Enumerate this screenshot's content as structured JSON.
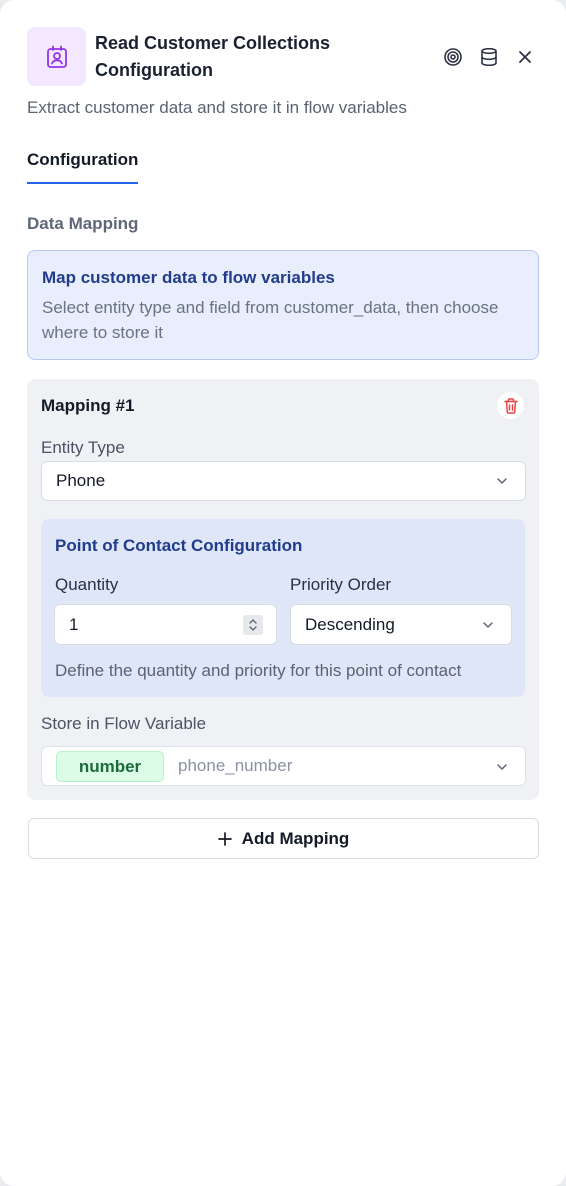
{
  "header": {
    "title": "Read Customer Collections Configuration",
    "subtitle": "Extract customer data and store it in flow variables",
    "node_icon": "contact-card-icon",
    "actions": [
      "target-icon",
      "database-icon",
      "close-icon"
    ]
  },
  "tabs": [
    {
      "label": "Configuration",
      "active": true
    }
  ],
  "section": {
    "label": "Data Mapping"
  },
  "info": {
    "title": "Map customer data to flow variables",
    "text": "Select entity type and field from customer_data, then choose where to store it"
  },
  "mapping": {
    "title": "Mapping #1",
    "entity_type_label": "Entity Type",
    "entity_type_value": "Phone",
    "poc": {
      "title": "Point of Contact Configuration",
      "quantity_label": "Quantity",
      "quantity_value": "1",
      "priority_label": "Priority Order",
      "priority_value": "Descending",
      "help": "Define the quantity and priority for this point of contact"
    },
    "store_label": "Store in Flow Variable",
    "var_type": "number",
    "var_placeholder": "phone_number"
  },
  "add_mapping_label": "Add Mapping",
  "colors": {
    "accent": "#2563eb",
    "icon_purple": "#9333ea",
    "danger": "#ef4444",
    "success_text": "#1c6b3c"
  }
}
